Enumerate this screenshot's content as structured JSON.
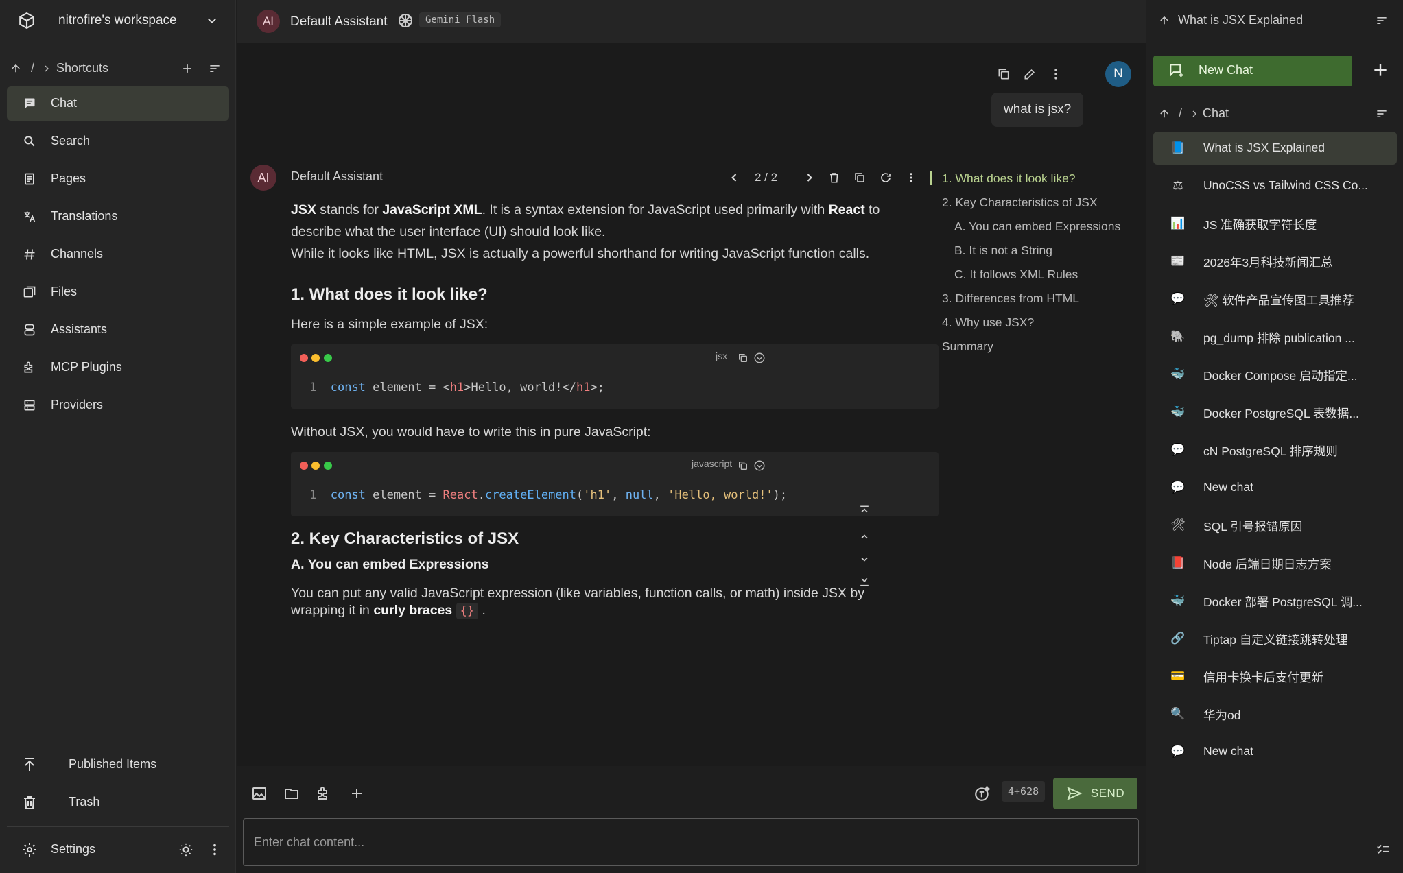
{
  "workspace": {
    "name": "nitrofire's workspace"
  },
  "left_breadcrumb": {
    "root": "/",
    "title": "Shortcuts"
  },
  "nav": [
    {
      "label": "Chat",
      "icon": "chat-icon",
      "active": true
    },
    {
      "label": "Search",
      "icon": "search-icon"
    },
    {
      "label": "Pages",
      "icon": "page-icon"
    },
    {
      "label": "Translations",
      "icon": "translate-icon"
    },
    {
      "label": "Channels",
      "icon": "hash-icon"
    },
    {
      "label": "Files",
      "icon": "files-icon"
    },
    {
      "label": "Assistants",
      "icon": "assistant-icon"
    },
    {
      "label": "MCP Plugins",
      "icon": "plugin-icon"
    },
    {
      "label": "Providers",
      "icon": "providers-icon"
    }
  ],
  "bottom_nav": {
    "published": "Published Items",
    "trash": "Trash",
    "settings": "Settings"
  },
  "topbar": {
    "assistant_initials": "AI",
    "assistant_name": "Default Assistant",
    "model": "Gemini Flash"
  },
  "user": {
    "initial": "N",
    "message": "what is jsx?"
  },
  "reply": {
    "avatar": "AI",
    "name": "Default Assistant",
    "pager": "2 / 2",
    "intro_1_b1": "JSX",
    "intro_1_t1": " stands for ",
    "intro_1_b2": "JavaScript XML",
    "intro_1_t2": ". It is a syntax extension for JavaScript used primarily with ",
    "intro_1_b3": "React",
    "intro_1_t3": " to describe what the user interface (UI) should look like.",
    "intro_2": "While it looks like HTML, JSX is actually a powerful shorthand for writing JavaScript function calls.",
    "h1": "1. What does it look like?",
    "p_example": "Here is a simple example of JSX:",
    "code1": {
      "lang": "jsx",
      "line_no": "1",
      "kw": "const",
      "t1": " element = <",
      "tag_open": "h1",
      "t2": ">Hello, world!</",
      "tag_close": "h1",
      "t3": ">;"
    },
    "p_without": "Without JSX, you would have to write this in pure JavaScript:",
    "code2": {
      "lang": "javascript",
      "line_no": "1",
      "kw": "const",
      "t1": " element = ",
      "obj": "React",
      "dot": ".",
      "fn": "createElement",
      "t2": "(",
      "s1": "'h1'",
      "comma1": ", ",
      "nul": "null",
      "comma2": ", ",
      "s2": "'Hello, world!'",
      "t3": ");"
    },
    "h2": "2. Key Characteristics of JSX",
    "h3": "A. You can embed Expressions",
    "p_embed_1": "You can put any valid JavaScript expression (like variables, function calls, or math) inside JSX by",
    "p_embed_2a": "wrapping it in ",
    "p_embed_2b": "curly braces",
    "p_embed_code": "{}",
    "p_embed_2c": " ."
  },
  "toc": [
    "1. What does it look like?",
    "2. Key Characteristics of JSX",
    "A. You can embed Expressions",
    "B. It is not a String",
    "C. It follows XML Rules",
    "3. Differences from HTML",
    "4. Why use JSX?",
    "Summary"
  ],
  "composer": {
    "placeholder": "Enter chat content...",
    "tokens": "4+628",
    "send": "SEND"
  },
  "right": {
    "page_title": "What is JSX Explained",
    "new_chat": "New Chat",
    "breadcrumb_root": "/",
    "breadcrumb_title": "Chat",
    "chats": [
      {
        "label": "What is JSX Explained",
        "icon": "📘",
        "active": true
      },
      {
        "label": "UnoCSS vs Tailwind CSS Co...",
        "icon": "⚖"
      },
      {
        "label": "JS 准确获取字符长度",
        "icon": "📊"
      },
      {
        "label": "2026年3月科技新闻汇总",
        "icon": "📰"
      },
      {
        "label": "🛠 软件产品宣传图工具推荐",
        "icon": "💬"
      },
      {
        "label": "pg_dump 排除 publication ...",
        "icon": "🐘"
      },
      {
        "label": "Docker Compose 启动指定...",
        "icon": "🐳"
      },
      {
        "label": "Docker PostgreSQL 表数据...",
        "icon": "🐳"
      },
      {
        "label": "cN PostgreSQL 排序规则",
        "icon": "💬"
      },
      {
        "label": "New chat",
        "icon": "💬"
      },
      {
        "label": "SQL 引号报错原因",
        "icon": "🛠"
      },
      {
        "label": "Node 后端日期日志方案",
        "icon": "📕"
      },
      {
        "label": "Docker 部署 PostgreSQL 调...",
        "icon": "🐳"
      },
      {
        "label": "Tiptap 自定义链接跳转处理",
        "icon": "🔗"
      },
      {
        "label": "信用卡换卡后支付更新",
        "icon": "💳"
      },
      {
        "label": "华为od",
        "icon": "🔍"
      },
      {
        "label": "New chat",
        "icon": "💬"
      }
    ]
  },
  "colors": {
    "accent": "#3e6b2f",
    "active_bg": "#3a3d36",
    "toc_active": "#b9d28f"
  }
}
